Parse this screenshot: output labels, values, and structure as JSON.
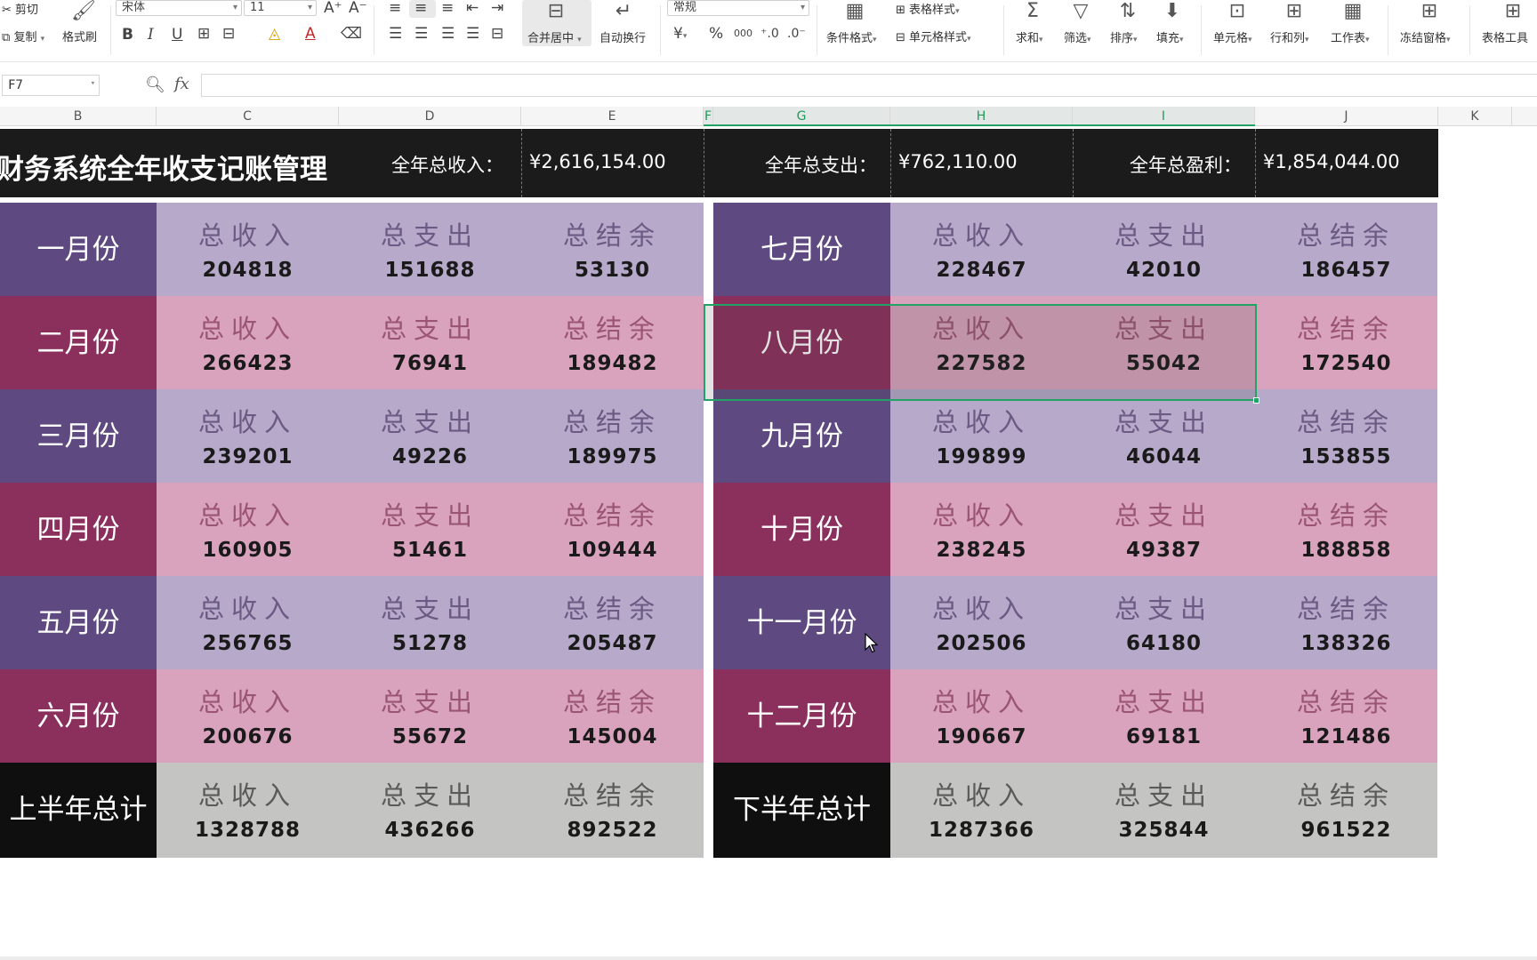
{
  "ribbon": {
    "clipboard": {
      "cut": "剪切",
      "copy": "复制",
      "format_painter": "格式刷"
    },
    "font": {
      "name": "宋体",
      "size": "11",
      "bold": "B",
      "italic": "I",
      "underline": "U"
    },
    "alignment": {
      "merge_center": "合并居中",
      "wrap_text": "自动换行"
    },
    "number": {
      "format": "常规",
      "currency": "¥",
      "percent": "%",
      "thousands": "000",
      "inc_decimal": "+.0\n.00",
      "dec_decimal": ".00\n→.0"
    },
    "styles": {
      "table_style": "表格样式",
      "conditional_format": "条件格式",
      "cell_style": "单元格样式"
    },
    "editing": {
      "sum": "求和",
      "filter": "筛选",
      "sort": "排序",
      "fill": "填充"
    },
    "cells": {
      "cell": "单元格",
      "row_col": "行和列",
      "worksheet": "工作表",
      "freeze": "冻结窗格",
      "table_tools": "表格工具"
    }
  },
  "formula_bar": {
    "cell_ref": "F7",
    "zoom_icon": "magnifier-icon",
    "fx": "fx",
    "formula": ""
  },
  "columns": [
    "B",
    "C",
    "D",
    "E",
    "F",
    "G",
    "H",
    "I",
    "J",
    "K"
  ],
  "summary": {
    "title": "财务系统全年收支记账管理",
    "income_label": "全年总收入：",
    "income_value": "¥2,616,154.00",
    "expense_label": "全年总支出：",
    "expense_value": "¥762,110.00",
    "profit_label": "全年总盈利：",
    "profit_value": "¥1,854,044.00"
  },
  "labels": {
    "income": "总收入",
    "expense": "总支出",
    "balance": "总结余"
  },
  "left_months": [
    {
      "name": "一月份",
      "income": "204818",
      "expense": "151688",
      "balance": "53130"
    },
    {
      "name": "二月份",
      "income": "266423",
      "expense": "76941",
      "balance": "189482"
    },
    {
      "name": "三月份",
      "income": "239201",
      "expense": "49226",
      "balance": "189975"
    },
    {
      "name": "四月份",
      "income": "160905",
      "expense": "51461",
      "balance": "109444"
    },
    {
      "name": "五月份",
      "income": "256765",
      "expense": "51278",
      "balance": "205487"
    },
    {
      "name": "六月份",
      "income": "200676",
      "expense": "55672",
      "balance": "145004"
    },
    {
      "name": "上半年总计",
      "income": "1328788",
      "expense": "436266",
      "balance": "892522"
    }
  ],
  "right_months": [
    {
      "name": "七月份",
      "income": "228467",
      "expense": "42010",
      "balance": "186457"
    },
    {
      "name": "八月份",
      "income": "227582",
      "expense": "55042",
      "balance": "172540"
    },
    {
      "name": "九月份",
      "income": "199899",
      "expense": "46044",
      "balance": "153855"
    },
    {
      "name": "十月份",
      "income": "238245",
      "expense": "49387",
      "balance": "188858"
    },
    {
      "name": "十一月份",
      "income": "202506",
      "expense": "64180",
      "balance": "138326"
    },
    {
      "name": "十二月份",
      "income": "190667",
      "expense": "69181",
      "balance": "121486"
    },
    {
      "name": "下半年总计",
      "income": "1287366",
      "expense": "325844",
      "balance": "961522"
    }
  ],
  "colors": {
    "purple_label": "#5e4a80",
    "purple_cells": "#b6a9c9",
    "pink_label": "#8b2f5d",
    "pink_cells": "#d9a3bd",
    "total_label": "#0f0f0f",
    "total_cells": "#c4c4c2",
    "selection": "#21a366"
  }
}
